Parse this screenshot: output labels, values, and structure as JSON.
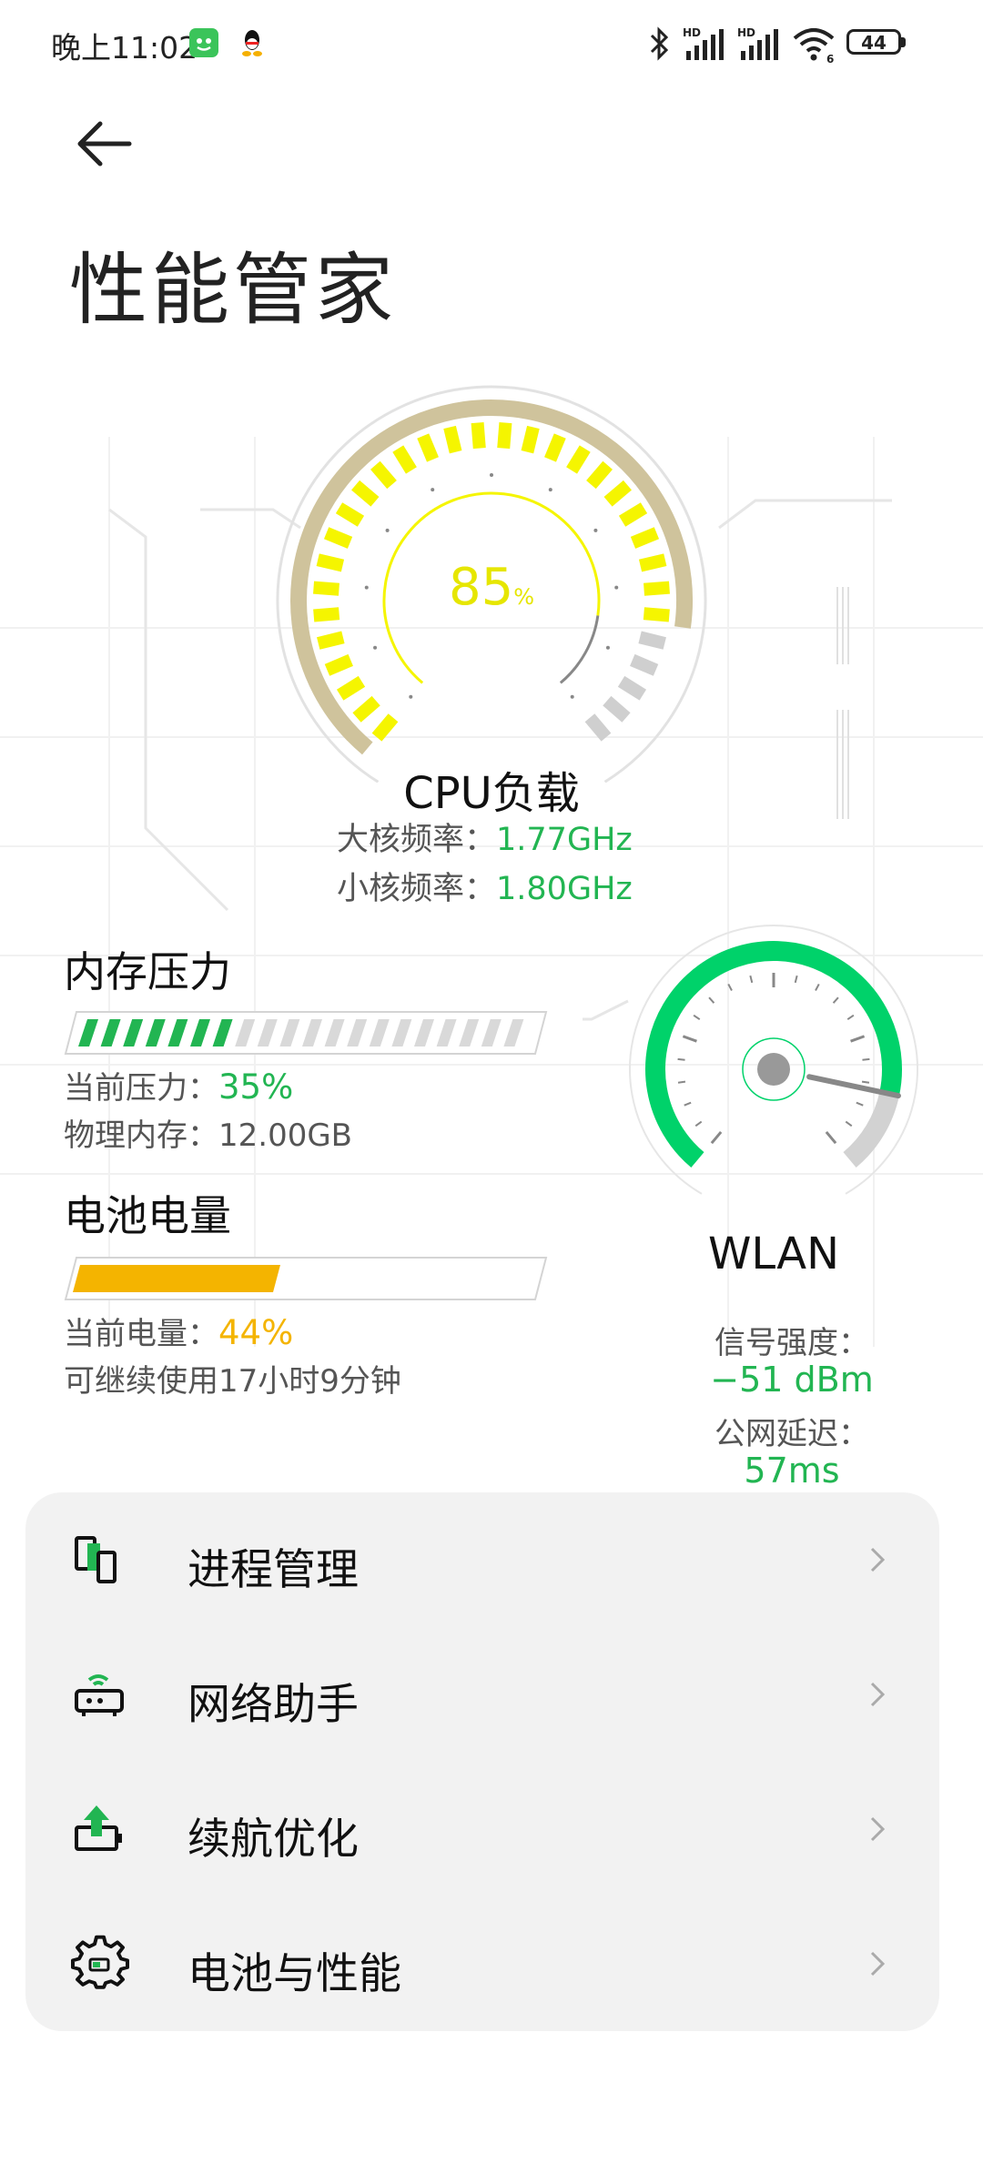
{
  "status_bar": {
    "time": "晚上11:02",
    "battery": "44",
    "icons": [
      "wechat-icon",
      "qq-icon",
      "bluetooth-icon",
      "signal-hd-icon",
      "signal-hd-icon",
      "wifi-6-icon",
      "battery-icon"
    ]
  },
  "header": {
    "title": "性能管家"
  },
  "cpu": {
    "load_value": "85",
    "load_unit": "%",
    "label": "CPU负载",
    "big_core_label": "大核频率：",
    "big_core_value": "1.77GHz",
    "small_core_label": "小核频率：",
    "small_core_value": "1.80GHz",
    "load_fraction": 0.85
  },
  "memory": {
    "title": "内存压力",
    "pressure_label": "当前压力：",
    "pressure_value": "35%",
    "physical_label": "物理内存：",
    "physical_value": "12.00GB",
    "pressure_fraction": 0.35
  },
  "battery": {
    "title": "电池电量",
    "level_label": "当前电量：",
    "level_value": "44%",
    "remaining": "可继续使用17小时9分钟",
    "level_fraction": 0.44
  },
  "wlan": {
    "label": "WLAN",
    "signal_label": "信号强度：",
    "signal_value": "−51 dBm",
    "latency_label": "公网延迟：",
    "latency_value": "57ms"
  },
  "menu": {
    "items": [
      {
        "label": "进程管理",
        "icon": "process-manager-icon"
      },
      {
        "label": "网络助手",
        "icon": "network-router-icon"
      },
      {
        "label": "续航优化",
        "icon": "battery-boost-icon"
      },
      {
        "label": "电池与性能",
        "icon": "gear-icon"
      }
    ]
  },
  "colors": {
    "accent_green": "#22b552",
    "cpu_yellow": "#f5f500",
    "battery_amber": "#f4b400",
    "gauge_tan": "#cfc39c",
    "wlan_green": "#00d26a"
  }
}
